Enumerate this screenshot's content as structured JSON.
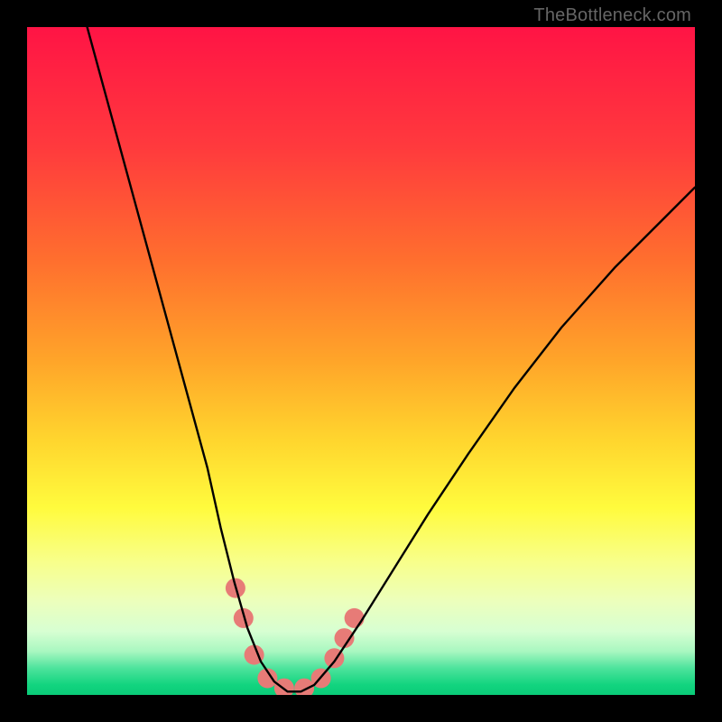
{
  "watermark": "TheBottleneck.com",
  "chart_data": {
    "type": "line",
    "title": "",
    "xlabel": "",
    "ylabel": "",
    "xlim": [
      0,
      100
    ],
    "ylim": [
      0,
      100
    ],
    "axes_visible": false,
    "background_gradient_stops": [
      {
        "pos": 0.0,
        "color": "#ff1445"
      },
      {
        "pos": 0.18,
        "color": "#ff3a3d"
      },
      {
        "pos": 0.35,
        "color": "#ff6f2e"
      },
      {
        "pos": 0.5,
        "color": "#ffa529"
      },
      {
        "pos": 0.62,
        "color": "#ffd62e"
      },
      {
        "pos": 0.72,
        "color": "#fffb3d"
      },
      {
        "pos": 0.8,
        "color": "#f8ff8a"
      },
      {
        "pos": 0.86,
        "color": "#ecffbc"
      },
      {
        "pos": 0.905,
        "color": "#d7ffd2"
      },
      {
        "pos": 0.935,
        "color": "#a8f7c0"
      },
      {
        "pos": 0.96,
        "color": "#4de39c"
      },
      {
        "pos": 0.985,
        "color": "#12d47f"
      },
      {
        "pos": 1.0,
        "color": "#0acb78"
      }
    ],
    "series": [
      {
        "name": "bottleneck-curve",
        "stroke": "#000000",
        "stroke_width": 2.4,
        "points": [
          {
            "x": 9.0,
            "y": 100.0
          },
          {
            "x": 12.0,
            "y": 89.0
          },
          {
            "x": 15.0,
            "y": 78.0
          },
          {
            "x": 18.0,
            "y": 67.0
          },
          {
            "x": 21.0,
            "y": 56.0
          },
          {
            "x": 24.0,
            "y": 45.0
          },
          {
            "x": 27.0,
            "y": 34.0
          },
          {
            "x": 29.0,
            "y": 25.0
          },
          {
            "x": 31.0,
            "y": 17.0
          },
          {
            "x": 33.0,
            "y": 10.0
          },
          {
            "x": 35.0,
            "y": 5.0
          },
          {
            "x": 37.0,
            "y": 2.0
          },
          {
            "x": 39.0,
            "y": 0.5
          },
          {
            "x": 41.0,
            "y": 0.5
          },
          {
            "x": 43.0,
            "y": 1.5
          },
          {
            "x": 46.0,
            "y": 5.0
          },
          {
            "x": 50.0,
            "y": 11.0
          },
          {
            "x": 55.0,
            "y": 19.0
          },
          {
            "x": 60.0,
            "y": 27.0
          },
          {
            "x": 66.0,
            "y": 36.0
          },
          {
            "x": 73.0,
            "y": 46.0
          },
          {
            "x": 80.0,
            "y": 55.0
          },
          {
            "x": 88.0,
            "y": 64.0
          },
          {
            "x": 95.0,
            "y": 71.0
          },
          {
            "x": 100.0,
            "y": 76.0
          }
        ]
      }
    ],
    "markers": {
      "name": "highlight-beads",
      "fill": "#e77b77",
      "radius": 11,
      "points": [
        {
          "x": 31.2,
          "y": 16.0
        },
        {
          "x": 32.4,
          "y": 11.5
        },
        {
          "x": 34.0,
          "y": 6.0
        },
        {
          "x": 36.0,
          "y": 2.5
        },
        {
          "x": 38.5,
          "y": 1.0
        },
        {
          "x": 41.5,
          "y": 1.0
        },
        {
          "x": 44.0,
          "y": 2.5
        },
        {
          "x": 46.0,
          "y": 5.5
        },
        {
          "x": 47.5,
          "y": 8.5
        },
        {
          "x": 49.0,
          "y": 11.5
        }
      ]
    }
  }
}
